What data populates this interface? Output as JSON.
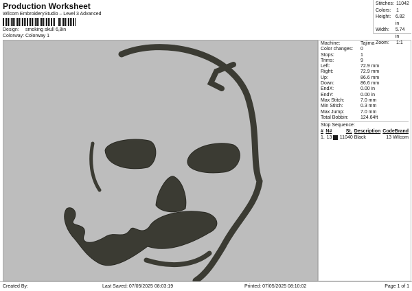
{
  "header": {
    "title": "Production Worksheet",
    "subtitle": "Wilcom EmbroideryStudio – Level 3 Advanced",
    "design_label": "Design:",
    "design": "smoking skull 6,8in",
    "colorway_label": "Colorway:",
    "colorway": "Colorway 1"
  },
  "stats": [
    {
      "k": "Stitches:",
      "v": "11042"
    },
    {
      "k": "Colors:",
      "v": "1"
    },
    {
      "k": "Height:",
      "v": "6.82 in"
    },
    {
      "k": "Width:",
      "v": "5.74 in"
    },
    {
      "k": "Zoom:",
      "v": "1:1"
    }
  ],
  "details": [
    {
      "k": "Machine:",
      "v": "Tajima"
    },
    {
      "k": "Color changes:",
      "v": "0"
    },
    {
      "k": "Stops:",
      "v": "1"
    },
    {
      "k": "Trims:",
      "v": "9"
    },
    {
      "k": "Left:",
      "v": "72.9 mm"
    },
    {
      "k": "Right:",
      "v": "72.9 mm"
    },
    {
      "k": "Up:",
      "v": "86.6 mm"
    },
    {
      "k": "Down:",
      "v": "86.6 mm"
    },
    {
      "k": "EndX:",
      "v": "0.00 in"
    },
    {
      "k": "EndY:",
      "v": "0.00 in"
    },
    {
      "k": "Max Stitch:",
      "v": "7.0 mm"
    },
    {
      "k": "Min Stitch:",
      "v": "0.3 mm"
    },
    {
      "k": "Max Jump:",
      "v": "7.0 mm"
    },
    {
      "k": "Total Bobbin:",
      "v": "124.64ft"
    }
  ],
  "stop_sequence": {
    "title": "Stop Sequence:",
    "headers": [
      "#",
      "N#",
      "St.",
      "Description",
      "Code",
      "Brand"
    ],
    "rows": [
      {
        "num": "1.",
        "n": "13",
        "swatch": "#1a1a1a",
        "st": "11040",
        "desc": "Black",
        "code": "13",
        "brand": "Wilcom"
      }
    ]
  },
  "colors": {
    "thread": "#3b3b33",
    "canvas": "#bdbdbd"
  },
  "footer": {
    "created": "Created By:",
    "saved": "Last Saved: 07/05/2025 08:03:19",
    "printed": "Printed: 07/05/2025 08:10:02",
    "page": "Page 1 of 1"
  }
}
